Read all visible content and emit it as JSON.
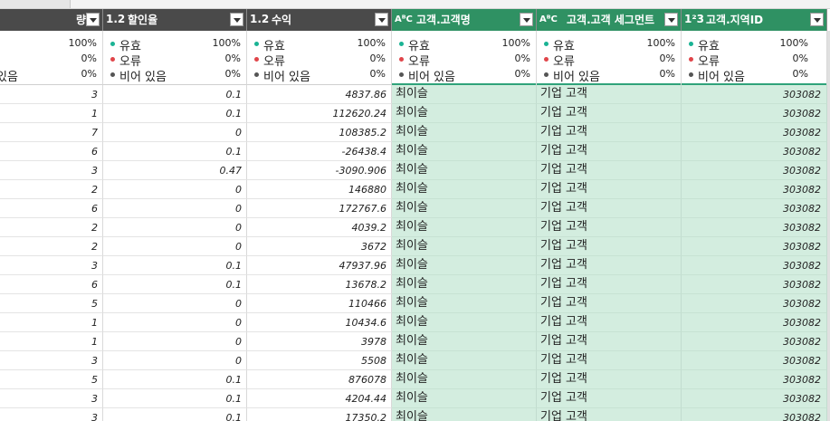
{
  "columns": [
    {
      "type_icon": "",
      "title": "량",
      "style": "dark"
    },
    {
      "type_icon": "1.2",
      "title": "할인율",
      "style": "dark"
    },
    {
      "type_icon": "1.2",
      "title": "수익",
      "style": "dark"
    },
    {
      "type_icon": "AᴮC",
      "title": "고객.고객명",
      "style": "green"
    },
    {
      "type_icon": "AᴮC",
      "title": "고객.고객 세그먼트",
      "style": "green"
    },
    {
      "type_icon": "1²3",
      "title": "고객.지역ID",
      "style": "green"
    }
  ],
  "quality": {
    "labels": {
      "valid": "유효",
      "error": "오류",
      "empty": "비어 있음"
    },
    "partial_empty_label": "있음",
    "percent": {
      "valid": "100%",
      "error": "0%",
      "empty": "0%"
    },
    "colors": {
      "valid": "#1ab394",
      "error": "#e0454a",
      "empty": "#555555"
    }
  },
  "rows": [
    [
      "3",
      "0.1",
      "4837.86",
      "최이슬",
      "기업 고객",
      "303082"
    ],
    [
      "1",
      "0.1",
      "112620.24",
      "최이슬",
      "기업 고객",
      "303082"
    ],
    [
      "7",
      "0",
      "108385.2",
      "최이슬",
      "기업 고객",
      "303082"
    ],
    [
      "6",
      "0.1",
      "-26438.4",
      "최이슬",
      "기업 고객",
      "303082"
    ],
    [
      "3",
      "0.47",
      "-3090.906",
      "최이슬",
      "기업 고객",
      "303082"
    ],
    [
      "2",
      "0",
      "146880",
      "최이슬",
      "기업 고객",
      "303082"
    ],
    [
      "6",
      "0",
      "172767.6",
      "최이슬",
      "기업 고객",
      "303082"
    ],
    [
      "2",
      "0",
      "4039.2",
      "최이슬",
      "기업 고객",
      "303082"
    ],
    [
      "2",
      "0",
      "3672",
      "최이슬",
      "기업 고객",
      "303082"
    ],
    [
      "3",
      "0.1",
      "47937.96",
      "최이슬",
      "기업 고객",
      "303082"
    ],
    [
      "6",
      "0.1",
      "13678.2",
      "최이슬",
      "기업 고객",
      "303082"
    ],
    [
      "5",
      "0",
      "110466",
      "최이슬",
      "기업 고객",
      "303082"
    ],
    [
      "1",
      "0",
      "10434.6",
      "최이슬",
      "기업 고객",
      "303082"
    ],
    [
      "1",
      "0",
      "3978",
      "최이슬",
      "기업 고객",
      "303082"
    ],
    [
      "3",
      "0",
      "5508",
      "최이슬",
      "기업 고객",
      "303082"
    ],
    [
      "5",
      "0.1",
      "876078",
      "최이슬",
      "기업 고객",
      "303082"
    ],
    [
      "3",
      "0.1",
      "4204.44",
      "최이슬",
      "기업 고객",
      "303082"
    ],
    [
      "3",
      "0.1",
      "17350.2",
      "최이슬",
      "기업 고객",
      "303082"
    ]
  ]
}
